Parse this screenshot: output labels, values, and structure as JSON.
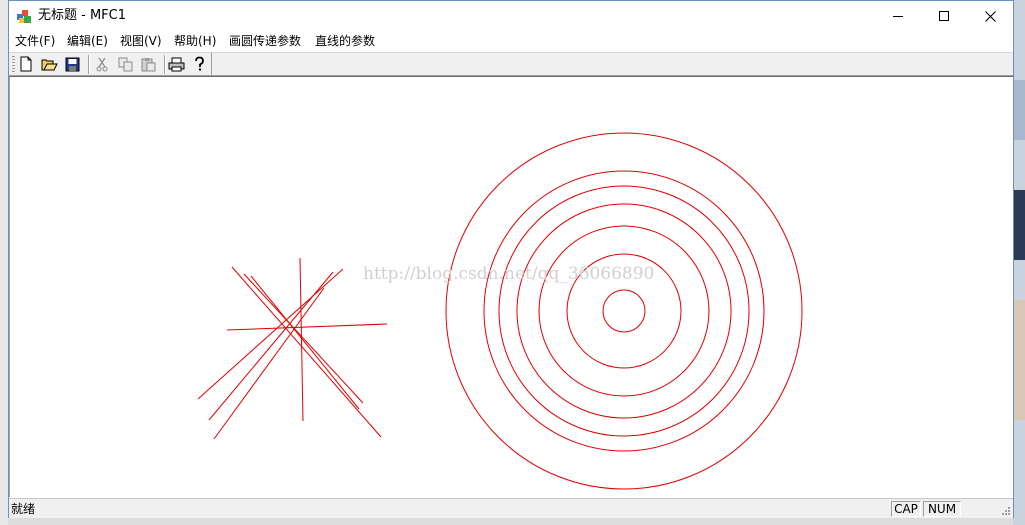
{
  "window": {
    "title": "无标题 - MFC1",
    "controls": [
      "minimize-icon",
      "maximize-icon",
      "close-icon"
    ]
  },
  "menu": {
    "items": [
      "文件(F)",
      "编辑(E)",
      "视图(V)",
      "帮助(H)",
      "画圆传递参数",
      "直线的参数"
    ]
  },
  "toolbar": {
    "buttons": [
      {
        "icon": "new-file-icon",
        "enabled": true
      },
      {
        "icon": "open-folder-icon",
        "enabled": true
      },
      {
        "icon": "save-icon",
        "enabled": true
      },
      {
        "icon": "cut-icon",
        "enabled": false
      },
      {
        "icon": "copy-icon",
        "enabled": false
      },
      {
        "icon": "paste-icon",
        "enabled": false
      },
      {
        "icon": "print-icon",
        "enabled": true
      },
      {
        "icon": "help-icon",
        "enabled": true
      }
    ]
  },
  "drawing": {
    "stroke_color": "#e00000",
    "circles": {
      "count": 7
    },
    "lines": {
      "count": 8
    }
  },
  "watermark": "http://blog.csdn.net/qq_36066890",
  "status": {
    "text": "就绪",
    "indicators": [
      "CAP",
      "NUM"
    ]
  }
}
